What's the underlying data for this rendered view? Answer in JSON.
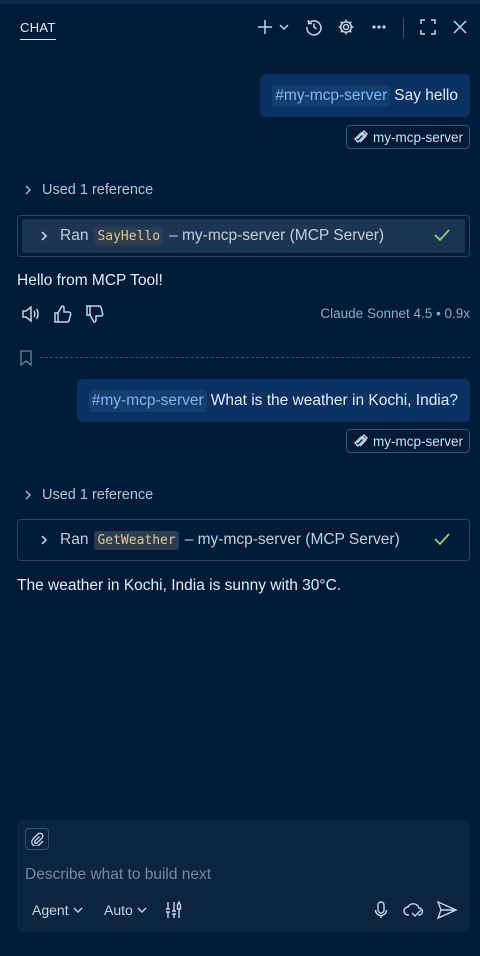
{
  "header": {
    "tab_label": "CHAT"
  },
  "messages": [
    {
      "user": {
        "mention": "#my-mcp-server",
        "text": "Say hello",
        "chip": "my-mcp-server"
      },
      "used_reference": "Used 1 reference",
      "tool": {
        "prefix": "Ran",
        "name": "SayHello",
        "suffix": "– my-mcp-server (MCP Server)"
      },
      "response": "Hello from MCP Tool!",
      "model_meta": "Claude Sonnet 4.5 • 0.9x"
    },
    {
      "user": {
        "mention": "#my-mcp-server",
        "text": "What is the weather in Kochi, India?",
        "chip": "my-mcp-server"
      },
      "used_reference": "Used 1 reference",
      "tool": {
        "prefix": "Ran",
        "name": "GetWeather",
        "suffix": "– my-mcp-server (MCP Server)"
      },
      "response": "The weather in Kochi, India is sunny with 30°C."
    }
  ],
  "input": {
    "placeholder": "Describe what to build next",
    "mode": "Agent",
    "model": "Auto"
  },
  "icons": {
    "header": [
      "plus-icon",
      "chevron-down-icon",
      "history-icon",
      "gear-icon",
      "ellipsis-icon",
      "maximize-icon",
      "close-icon"
    ],
    "actions": [
      "speaker-icon",
      "thumbs-up-icon",
      "thumbs-down-icon"
    ],
    "input": [
      "paperclip-icon",
      "tools-icon",
      "microphone-icon",
      "cloud-icon",
      "send-icon"
    ]
  },
  "colors": {
    "background": "#011c39",
    "user_bubble": "#0a3263",
    "mention": "#7fb6f2",
    "check": "#89d185"
  }
}
